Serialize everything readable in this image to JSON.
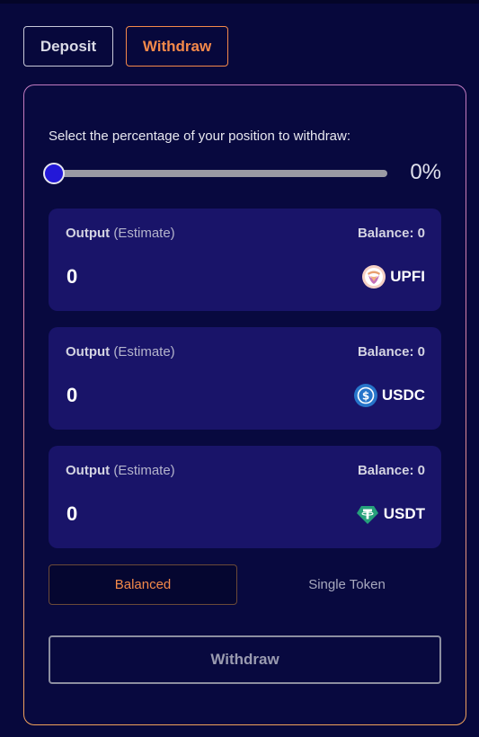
{
  "tabs": {
    "deposit": "Deposit",
    "withdraw": "Withdraw",
    "active": "withdraw"
  },
  "withdraw_panel": {
    "instruction": "Select the percentage of your position to withdraw:",
    "slider": {
      "percent": 0,
      "value_label": "0%"
    },
    "outputs": [
      {
        "label": "Output",
        "label_suffix": "(Estimate)",
        "balance": "Balance: 0",
        "amount": "0",
        "token": "UPFI",
        "icon": "upfi-token-icon"
      },
      {
        "label": "Output",
        "label_suffix": "(Estimate)",
        "balance": "Balance: 0",
        "amount": "0",
        "token": "USDC",
        "icon": "usdc-token-icon"
      },
      {
        "label": "Output",
        "label_suffix": "(Estimate)",
        "balance": "Balance: 0",
        "amount": "0",
        "token": "USDT",
        "icon": "usdt-token-icon"
      }
    ],
    "modes": {
      "balanced": "Balanced",
      "single_token": "Single Token",
      "active": "balanced"
    },
    "submit_label": "Withdraw"
  },
  "colors": {
    "background": "#07083c",
    "card": "#191469",
    "accent": "#f4894a",
    "slider_thumb": "#2318d8"
  }
}
